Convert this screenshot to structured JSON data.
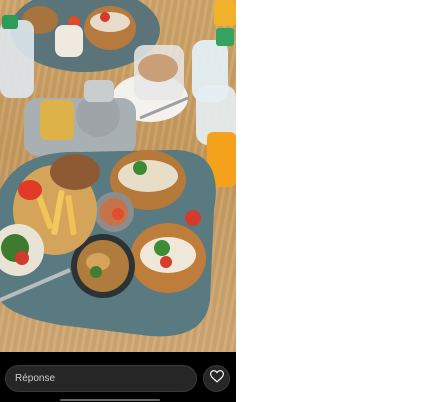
{
  "reply": {
    "placeholder": "Réponse"
  },
  "icons": {
    "like": "heart-icon"
  },
  "colors": {
    "table": "#c9a46c",
    "plate": "#5f7f86",
    "bar_bg": "#262626"
  }
}
